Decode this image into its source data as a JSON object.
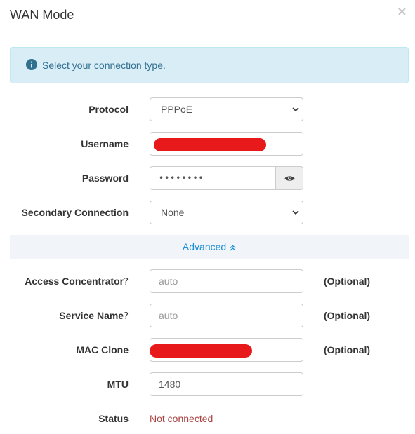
{
  "modal": {
    "title": "WAN Mode",
    "close_glyph": "×"
  },
  "alert": {
    "icon": "info-circle-icon",
    "text": "Select your connection type."
  },
  "form": {
    "protocol": {
      "label": "Protocol",
      "value": "PPPoE"
    },
    "username": {
      "label": "Username",
      "value": ""
    },
    "password": {
      "label": "Password",
      "value": "••••••••"
    },
    "secondary_connection": {
      "label": "Secondary Connection",
      "value": "None"
    }
  },
  "advanced": {
    "label": "Advanced",
    "chevron": "»"
  },
  "advanced_form": {
    "access_concentrator": {
      "label": "Access Concentrator",
      "help": "?",
      "placeholder": "auto",
      "optional": "(Optional)"
    },
    "service_name": {
      "label": "Service Name",
      "help": "?",
      "placeholder": "auto",
      "optional": "(Optional)"
    },
    "mac_clone": {
      "label": "MAC Clone",
      "value": "",
      "optional": "(Optional)"
    },
    "mtu": {
      "label": "MTU",
      "value": "1480"
    },
    "status": {
      "label": "Status",
      "value": "Not connected"
    }
  },
  "colors": {
    "alert_bg": "#d9edf7",
    "alert_text": "#31708f",
    "link": "#1a8ed6",
    "status_error": "#a94442",
    "redaction": "#e8191a"
  }
}
